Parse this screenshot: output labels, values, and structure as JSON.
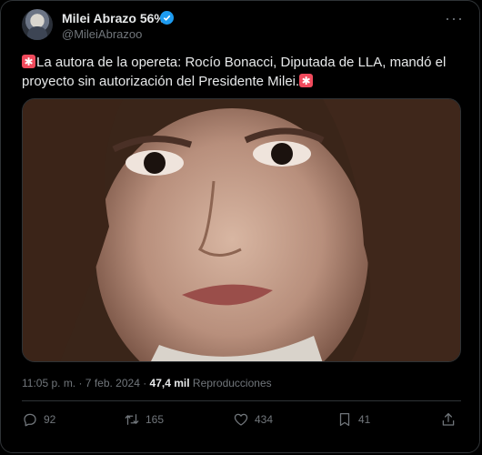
{
  "author": {
    "name": "Milei Abrazo 56%",
    "handle": "@MileiAbrazoo",
    "verified": true
  },
  "tweet": {
    "text_line1": "La autora de la opereta: Rocío Bonacci, Diputada de LLA, mandó el",
    "text_line2": "proyecto sin autorización del Presidente Milei.",
    "emoji": "rotating-light-emoji",
    "timestamp": "11:05 p. m. · 7 feb. 2024 · ",
    "views_count": "47,4 mil",
    "views_label": " Reproducciones"
  },
  "actions": {
    "replies": "92",
    "retweets": "165",
    "likes": "434",
    "bookmarks": "41"
  },
  "icons": [
    "more-icon",
    "verified-badge-icon",
    "reply-icon",
    "retweet-icon",
    "like-icon",
    "bookmark-icon",
    "share-icon"
  ],
  "colors": {
    "background": "#000000",
    "text": "#e7e9ea",
    "muted": "#71767b",
    "verified": "#1d9bf0",
    "border": "#2f3336"
  }
}
